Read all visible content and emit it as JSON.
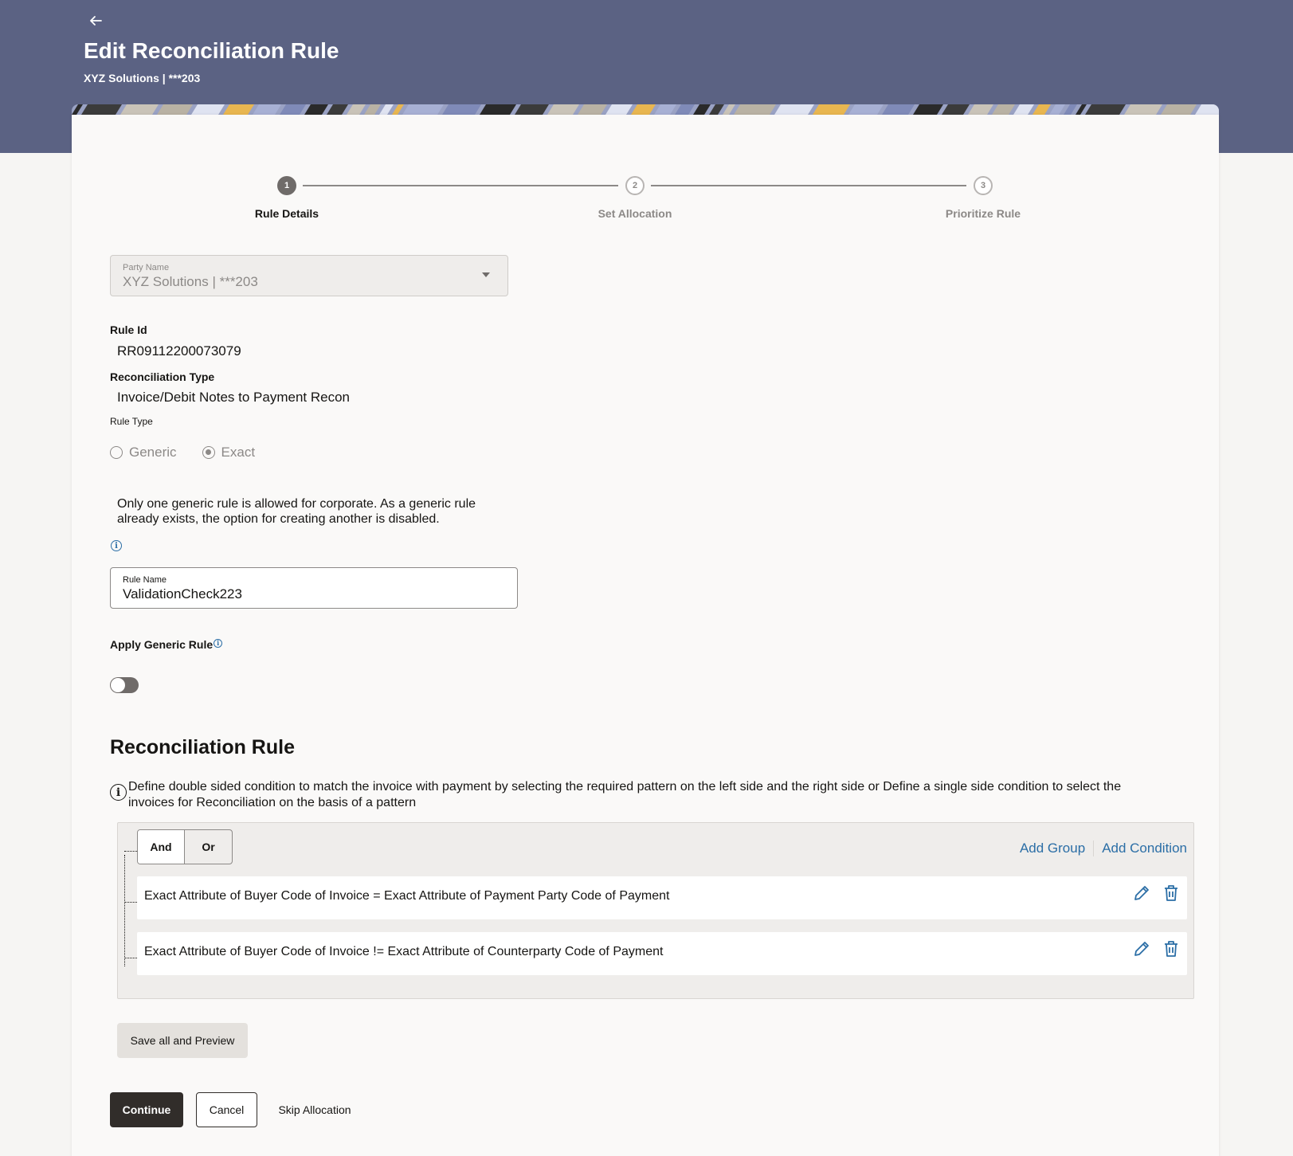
{
  "header": {
    "back_icon": "arrow-left-icon",
    "title": "Edit Reconciliation Rule",
    "subtitle": "XYZ Solutions | ***203",
    "background_color": "#5b6283"
  },
  "stepper": {
    "steps": [
      {
        "number": "1",
        "label": "Rule Details",
        "state": "active"
      },
      {
        "number": "2",
        "label": "Set Allocation",
        "state": "inactive"
      },
      {
        "number": "3",
        "label": "Prioritize Rule",
        "state": "inactive"
      }
    ]
  },
  "form": {
    "party_name": {
      "label": "Party Name",
      "value": "XYZ Solutions | ***203"
    },
    "rule_id": {
      "label": "Rule Id",
      "value": "RR09112200073079"
    },
    "recon_type": {
      "label": "Reconciliation Type",
      "value": "Invoice/Debit Notes to Payment Recon"
    },
    "rule_type": {
      "label": "Rule Type",
      "options": [
        {
          "label": "Generic",
          "checked": false
        },
        {
          "label": "Exact",
          "checked": true
        }
      ]
    },
    "generic_note": "Only one generic rule is allowed for corporate. As a generic rule already exists, the option for creating another is disabled.",
    "info_glyph": "i",
    "rule_name": {
      "label": "Rule Name",
      "value": "ValidationCheck223"
    },
    "apply_generic": {
      "label": "Apply Generic Rule",
      "enabled": false
    }
  },
  "recon_rule": {
    "title": "Reconciliation Rule",
    "description": "Define double sided condition to match the invoice with payment by selecting the required pattern on the left side and the right side or Define a single side condition to select the invoices for Reconciliation on the basis of a pattern",
    "operators": [
      {
        "label": "And",
        "selected": true
      },
      {
        "label": "Or",
        "selected": false
      }
    ],
    "add_group": "Add Group",
    "add_condition": "Add Condition",
    "conditions": [
      "Exact Attribute of Buyer Code of Invoice = Exact Attribute of Payment Party Code of Payment",
      "Exact Attribute of Buyer Code of Invoice != Exact Attribute of Counterparty Code of Payment"
    ],
    "link_color": "#2b6ea6"
  },
  "buttons": {
    "save_preview": "Save all and Preview",
    "continue": "Continue",
    "cancel": "Cancel",
    "skip": "Skip Allocation"
  }
}
